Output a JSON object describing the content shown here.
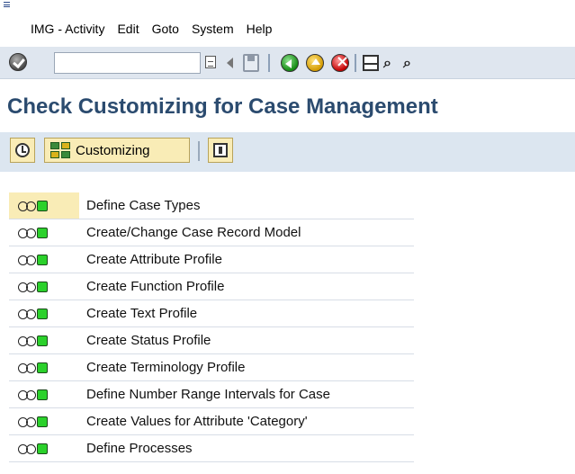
{
  "menubar": {
    "items": [
      {
        "label": "IMG - Activity"
      },
      {
        "label": "Edit"
      },
      {
        "label": "Goto"
      },
      {
        "label": "System"
      },
      {
        "label": "Help"
      }
    ]
  },
  "std_toolbar": {
    "command_field_value": "",
    "icons": [
      "ok-icon",
      "history-icon",
      "back-arrow-icon",
      "save-icon",
      "back-icon",
      "exit-icon",
      "cancel-icon",
      "print-icon",
      "find-icon",
      "find-next-icon"
    ]
  },
  "page": {
    "title": "Check Customizing for Case Management"
  },
  "app_toolbar": {
    "customizing_label": "Customizing"
  },
  "activities": [
    {
      "label": "Define Case Types",
      "selected": true
    },
    {
      "label": "Create/Change Case Record Model"
    },
    {
      "label": "Create Attribute Profile"
    },
    {
      "label": "Create Function Profile"
    },
    {
      "label": "Create Text Profile"
    },
    {
      "label": "Create Status Profile"
    },
    {
      "label": "Create Terminology Profile"
    },
    {
      "label": "Define Number Range Intervals for Case"
    },
    {
      "label": "Create Values for Attribute 'Category'"
    },
    {
      "label": "Define Processes"
    }
  ],
  "colors": {
    "title": "#2b4b6f",
    "toolbar_bg": "#dce6f0",
    "button_bg": "#f9ecb6",
    "status_green": "#2bd12b"
  }
}
